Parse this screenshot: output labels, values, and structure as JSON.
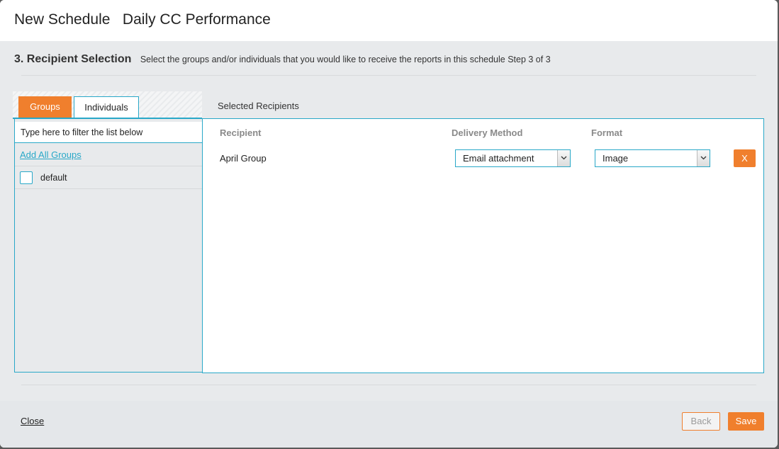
{
  "header": {
    "title": "New Schedule   Daily CC Performance"
  },
  "step": {
    "title": "3. Recipient Selection",
    "description": "Select the groups and/or individuals that you would like to receive the reports in this schedule Step 3 of 3"
  },
  "tabs": [
    {
      "label": "Groups",
      "active": true
    },
    {
      "label": "Individuals",
      "active": false
    }
  ],
  "filter": {
    "placeholder": "Type here to filter the list below",
    "value": ""
  },
  "groups_panel": {
    "add_all_label": "Add All Groups",
    "items": [
      {
        "label": "default",
        "checked": false
      }
    ]
  },
  "selected_recipients": {
    "label": "Selected Recipients",
    "columns": {
      "recipient": "Recipient",
      "delivery": "Delivery Method",
      "format": "Format"
    },
    "rows": [
      {
        "recipient": "April Group",
        "delivery_method": "Email attachment",
        "format": "Image",
        "remove_label": "X"
      }
    ]
  },
  "footer": {
    "close_label": "Close",
    "back_label": "Back",
    "save_label": "Save"
  },
  "colors": {
    "accent": "#f07f2d",
    "border": "#29a8c8"
  },
  "icons": {
    "select_arrow": "chevron-down-icon"
  }
}
